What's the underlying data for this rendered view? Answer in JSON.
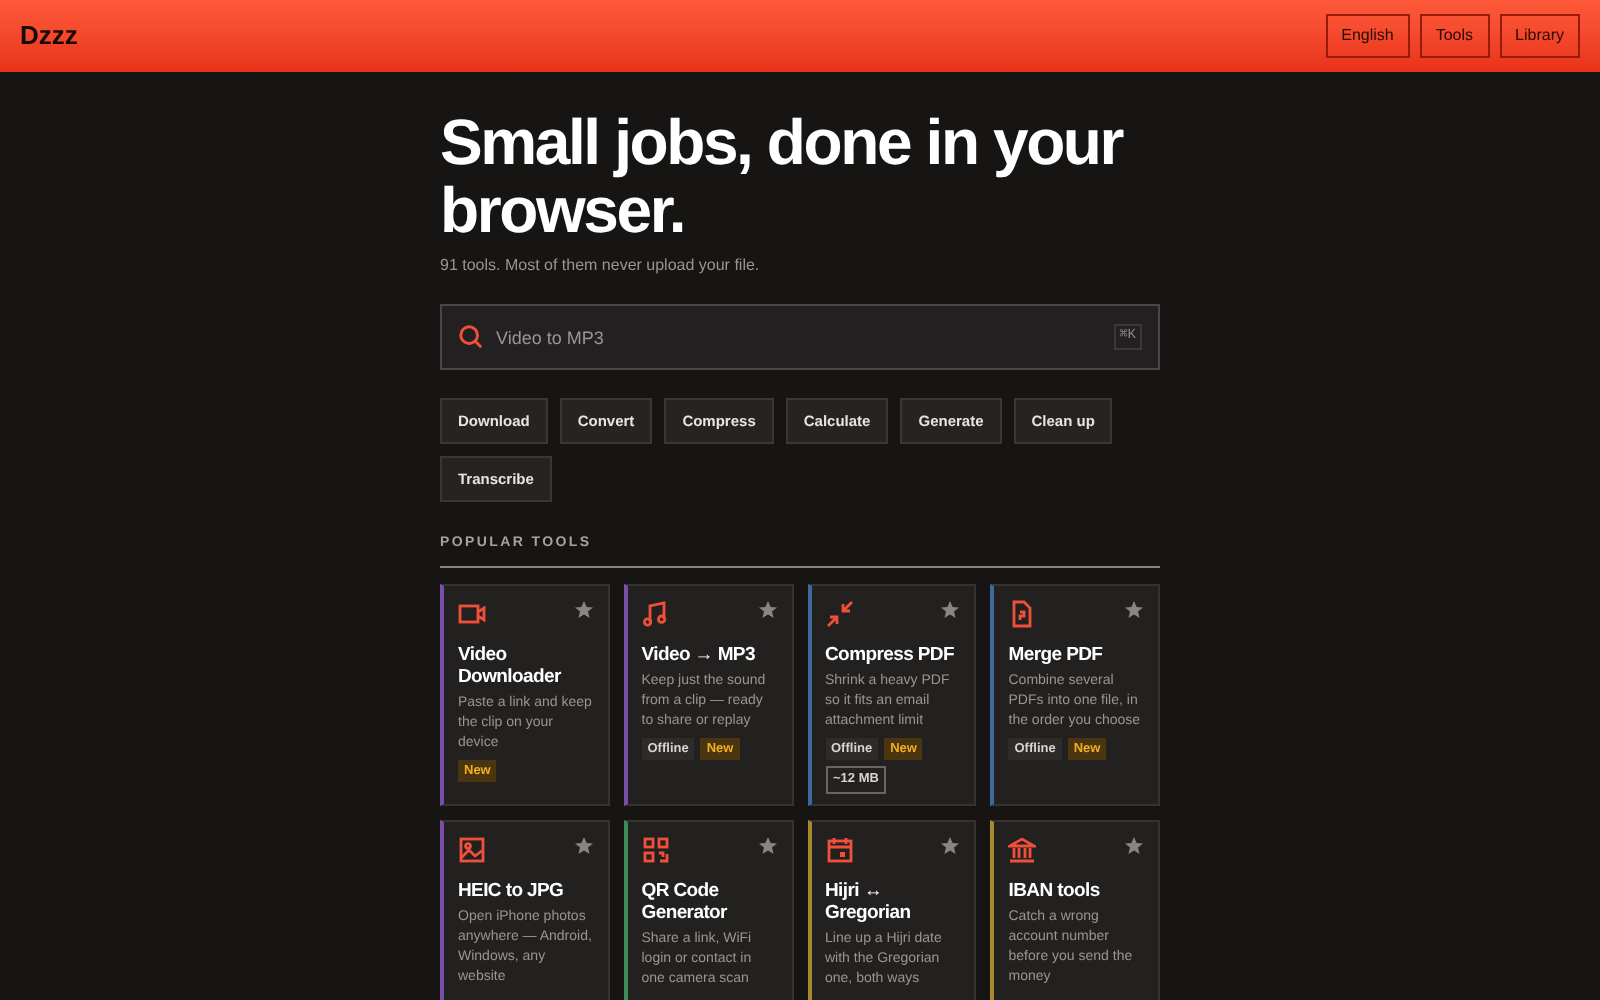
{
  "header": {
    "logo": "Dzzz",
    "nav": [
      "English",
      "Tools",
      "Library"
    ]
  },
  "hero": {
    "title": "Small jobs, done in your browser.",
    "subtitle": "91 tools. Most of them never upload your file."
  },
  "search": {
    "placeholder": "Video to MP3",
    "shortcut": "⌘K"
  },
  "categories": [
    "Download",
    "Convert",
    "Compress",
    "Calculate",
    "Generate",
    "Clean up",
    "Transcribe"
  ],
  "section_title": "POPULAR TOOLS",
  "tools": [
    {
      "title": "Video Downloader",
      "description": "Paste a link and keep the clip on your device",
      "color": "#7b4fa8",
      "badges": [
        {
          "kind": "new",
          "text": "New"
        }
      ]
    },
    {
      "title": "Video → MP3",
      "description": "Keep just the sound from a clip — ready to share or replay",
      "color": "#7b4fa8",
      "badges": [
        {
          "kind": "offline",
          "text": "Offline"
        },
        {
          "kind": "new",
          "text": "New"
        }
      ]
    },
    {
      "title": "Compress PDF",
      "description": "Shrink a heavy PDF so it fits an email attachment limit",
      "color": "#3d6a9a",
      "badges": [
        {
          "kind": "offline",
          "text": "Offline"
        },
        {
          "kind": "new",
          "text": "New"
        },
        {
          "kind": "size",
          "text": "~12 MB"
        }
      ]
    },
    {
      "title": "Merge PDF",
      "description": "Combine several PDFs into one file, in the order you choose",
      "color": "#3d6a9a",
      "badges": [
        {
          "kind": "offline",
          "text": "Offline"
        },
        {
          "kind": "new",
          "text": "New"
        }
      ]
    },
    {
      "title": "HEIC to JPG",
      "description": "Open iPhone photos anywhere — Android, Windows, any website",
      "color": "#7b4fa8"
    },
    {
      "title": "QR Code Generator",
      "description": "Share a link, WiFi login or contact in one camera scan",
      "color": "#3f8a5a"
    },
    {
      "title": "Hijri ↔ Gregorian",
      "description": "Line up a Hijri date with the Gregorian one, both ways",
      "color": "#a88a2a"
    },
    {
      "title": "IBAN tools",
      "description": "Catch a wrong account number before you send the money",
      "color": "#a88a2a"
    }
  ]
}
